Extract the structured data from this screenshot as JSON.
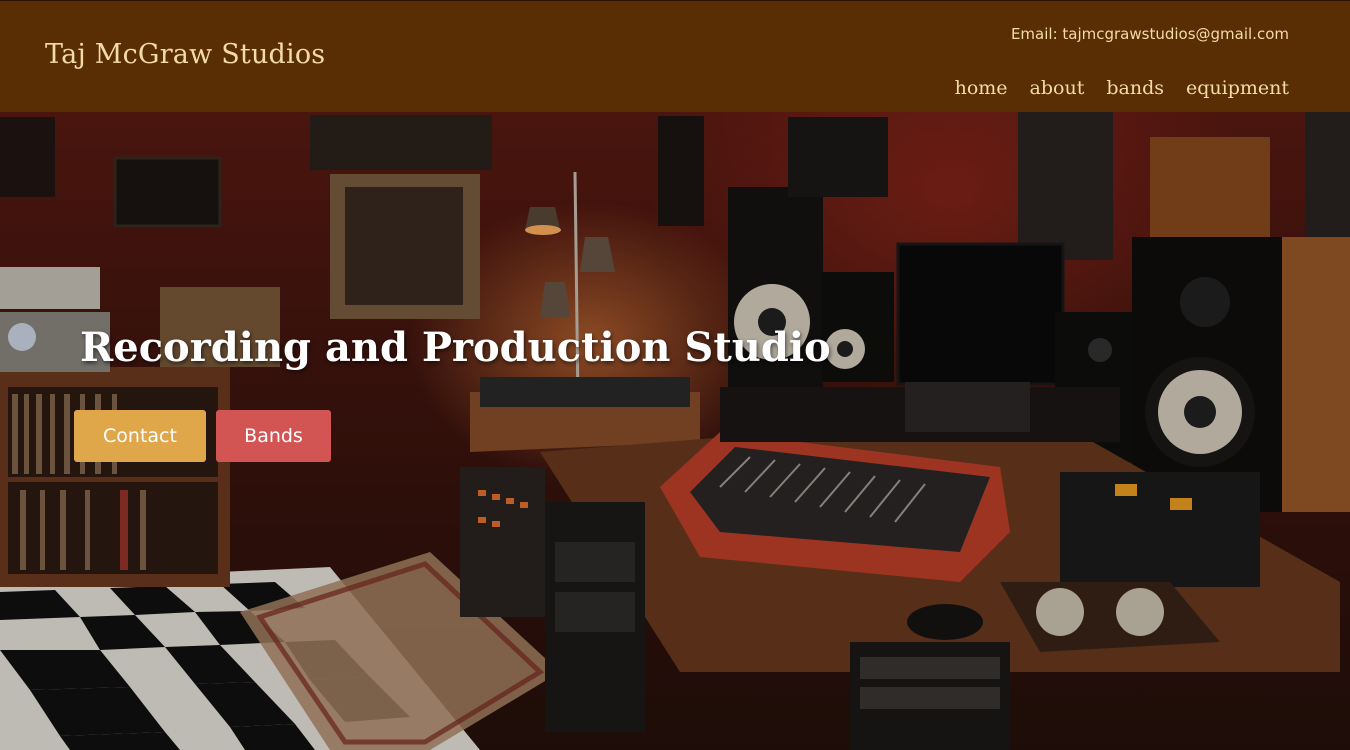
{
  "header": {
    "brand": "Taj McGraw Studios",
    "email": "Email: tajmcgrawstudios@gmail.com",
    "nav": [
      "home",
      "about",
      "bands",
      "equipment"
    ]
  },
  "hero": {
    "title": "Recording and Production Studio",
    "buttons": {
      "contact": "Contact",
      "bands": "Bands"
    },
    "image_description_icon": "studio-photo"
  },
  "colors": {
    "header_bg": "#5a2e05",
    "header_text": "#f3dba6",
    "contact_button": "#e0a64a",
    "bands_button": "#d35553"
  }
}
